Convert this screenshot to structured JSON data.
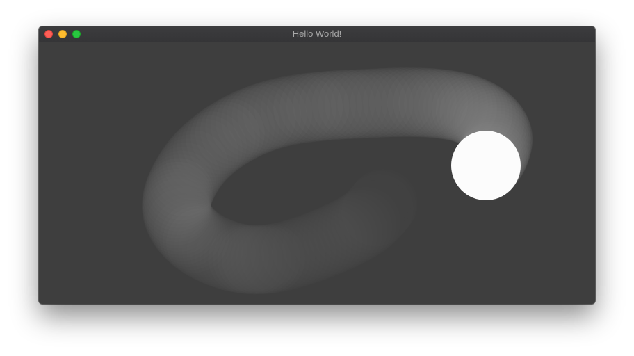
{
  "window": {
    "title": "Hello World!",
    "controls": {
      "close_color": "#fe5f57",
      "minimize_color": "#febc2e",
      "maximize_color": "#28c840"
    }
  },
  "canvas": {
    "background_color": "#3e3e3e",
    "ball_color": "#fcfcfc",
    "trail_color": "#8f8f8f"
  }
}
